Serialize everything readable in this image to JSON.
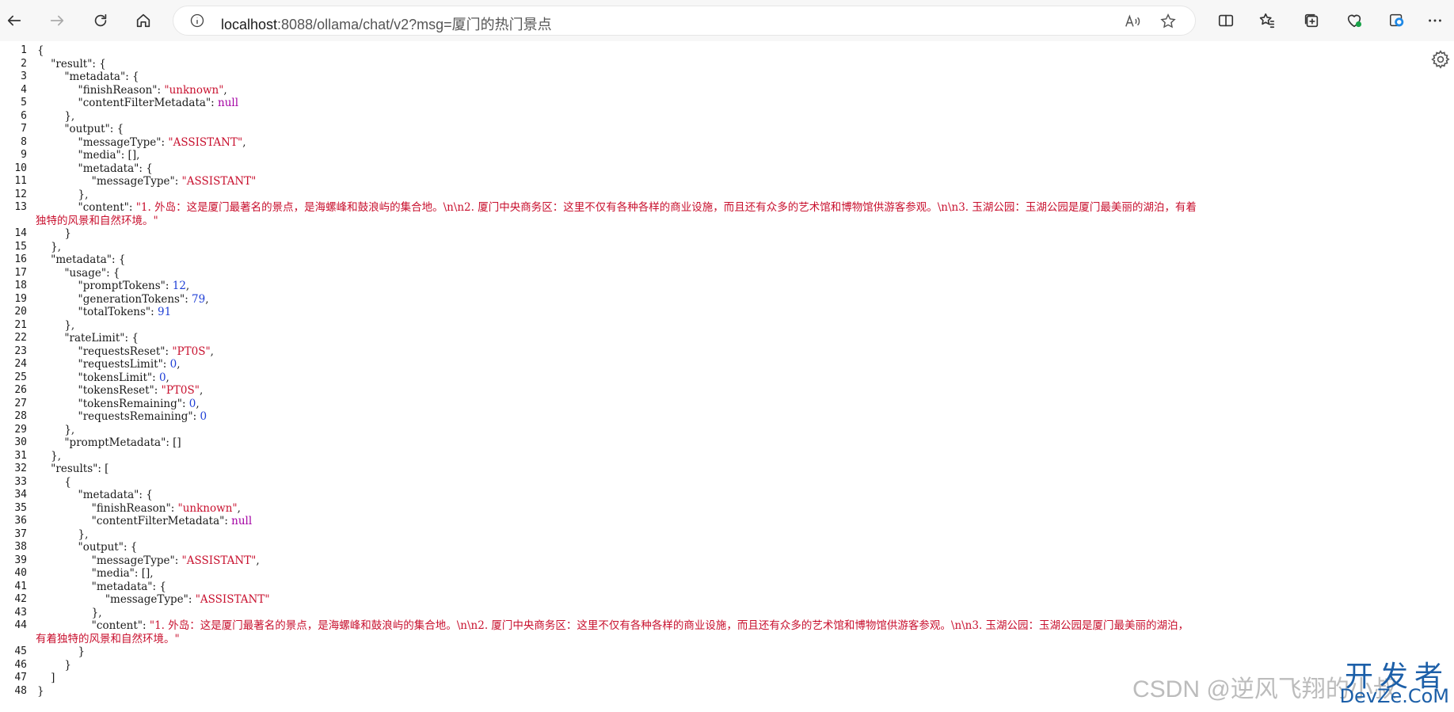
{
  "browser": {
    "url_host": "localhost",
    "url_rest": ":8088/ollama/chat/v2?msg=厦门的热门景点"
  },
  "gutter": [
    "1",
    "2",
    "3",
    "4",
    "5",
    "6",
    "7",
    "8",
    "9",
    "10",
    "11",
    "12",
    "13",
    "14",
    "15",
    "16",
    "17",
    "18",
    "19",
    "20",
    "21",
    "22",
    "23",
    "24",
    "25",
    "26",
    "27",
    "28",
    "29",
    "30",
    "31",
    "32",
    "33",
    "34",
    "35",
    "36",
    "37",
    "38",
    "39",
    "40",
    "41",
    "42",
    "43",
    "44",
    "45",
    "46",
    "47",
    "48"
  ],
  "json": {
    "key_result": "\"result\"",
    "key_metadata": "\"metadata\"",
    "key_finishReason": "\"finishReason\"",
    "val_unknown": "\"unknown\"",
    "key_contentFilterMetadata": "\"contentFilterMetadata\"",
    "val_null": "null",
    "key_output": "\"output\"",
    "key_messageType": "\"messageType\"",
    "val_assistant": "\"ASSISTANT\"",
    "key_media": "\"media\"",
    "key_content": "\"content\"",
    "content_line1": "\"1. 外岛：这是厦门最著名的景点，是海螺峰和鼓浪屿的集合地。\\n\\n2. 厦门中央商务区：这里不仅有各种各样的商业设施，而且还有众多的艺术馆和博物馆供游客参观。\\n\\n3. 玉湖公园：玉湖公园是厦门最美丽的湖泊，有着",
    "content_line2": "独特的风景和自然环境。\"",
    "content2_line1": "\"1. 外岛：这是厦门最著名的景点，是海螺峰和鼓浪屿的集合地。\\n\\n2. 厦门中央商务区：这里不仅有各种各样的商业设施，而且还有众多的艺术馆和博物馆供游客参观。\\n\\n3. 玉湖公园：玉湖公园是厦门最美丽的湖泊，",
    "content2_line2": "有着独特的风景和自然环境。\"",
    "key_usage": "\"usage\"",
    "key_promptTokens": "\"promptTokens\"",
    "val_promptTokens": "12",
    "key_generationTokens": "\"generationTokens\"",
    "val_generationTokens": "79",
    "key_totalTokens": "\"totalTokens\"",
    "val_totalTokens": "91",
    "key_rateLimit": "\"rateLimit\"",
    "key_requestsReset": "\"requestsReset\"",
    "val_pt0s": "\"PT0S\"",
    "key_requestsLimit": "\"requestsLimit\"",
    "val_zero": "0",
    "key_tokensLimit": "\"tokensLimit\"",
    "key_tokensReset": "\"tokensReset\"",
    "key_tokensRemaining": "\"tokensRemaining\"",
    "key_requestsRemaining": "\"requestsRemaining\"",
    "key_promptMetadata": "\"promptMetadata\"",
    "key_results": "\"results\""
  },
  "watermark": {
    "csdn": "CSDN @逆风飞翔的小叔",
    "big": "开发者",
    "sub": "DevZe.CoM"
  },
  "colors": {
    "key": "#1a1a1a",
    "string": "#c8102e",
    "number": "#1f3fd6",
    "null": "#a300a3"
  }
}
